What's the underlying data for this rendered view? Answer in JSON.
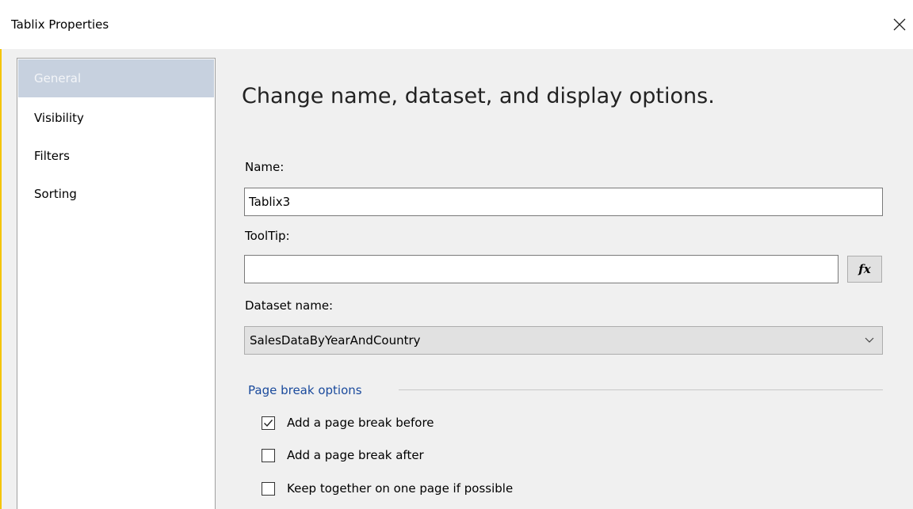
{
  "window": {
    "title": "Tablix Properties",
    "close_icon": "close-icon"
  },
  "sidebar": {
    "items": [
      {
        "label": "General",
        "selected": true
      },
      {
        "label": "Visibility",
        "selected": false
      },
      {
        "label": "Filters",
        "selected": false
      },
      {
        "label": "Sorting",
        "selected": false
      }
    ]
  },
  "main": {
    "heading": "Change name, dataset, and display options.",
    "name_label": "Name:",
    "name_value": "Tablix3",
    "tooltip_label": "ToolTip:",
    "tooltip_value": "",
    "fx_label": "fx",
    "dataset_label": "Dataset name:",
    "dataset_value": "SalesDataByYearAndCountry"
  },
  "page_break": {
    "group_label": "Page break options",
    "options": [
      {
        "label": "Add a page break before",
        "checked": true
      },
      {
        "label": "Add a page break after",
        "checked": false
      },
      {
        "label": "Keep together on one page if possible",
        "checked": false
      }
    ]
  },
  "colors": {
    "accent": "#f5c400",
    "selected_nav": "#c7d1df",
    "group_label": "#1a4a9c"
  }
}
